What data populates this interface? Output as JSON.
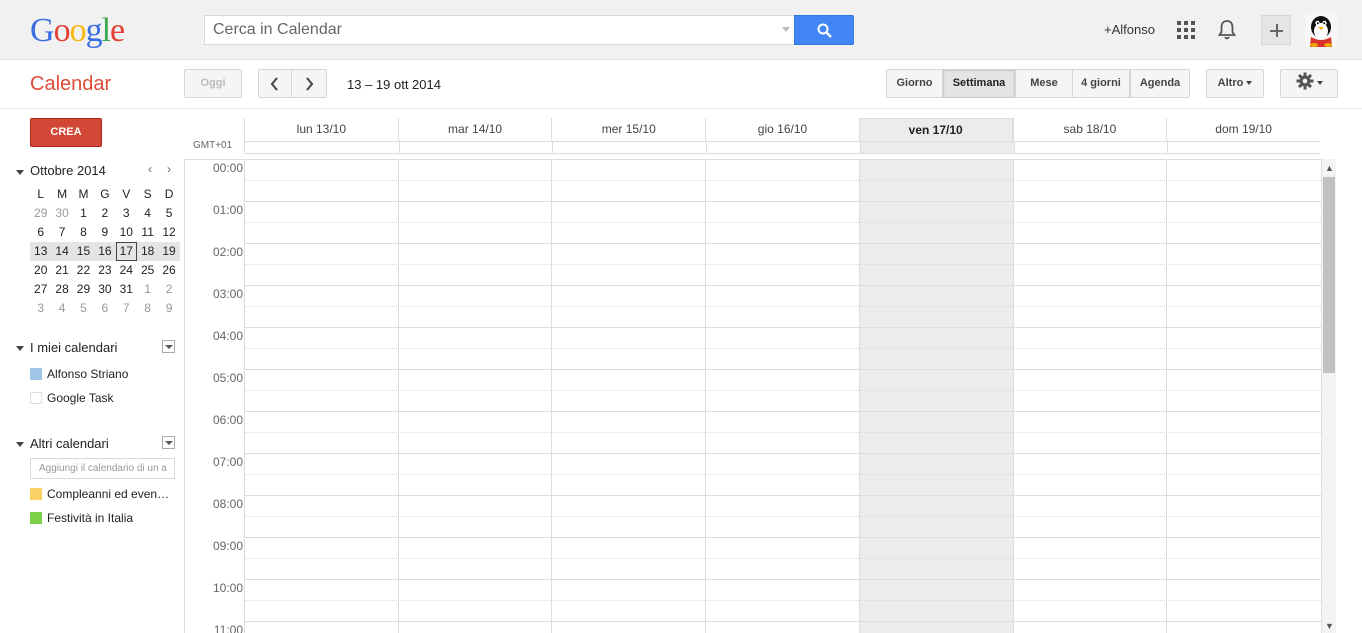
{
  "header": {
    "logo_letters": [
      {
        "ch": "G",
        "color": "#3b6ee3"
      },
      {
        "ch": "o",
        "color": "#e44134"
      },
      {
        "ch": "o",
        "color": "#f5b90f"
      },
      {
        "ch": "g",
        "color": "#3b6ee3"
      },
      {
        "ch": "l",
        "color": "#39a94c"
      },
      {
        "ch": "e",
        "color": "#e44134"
      }
    ],
    "search_placeholder": "Cerca in Calendar",
    "user_label": "+Alfonso"
  },
  "appbar": {
    "title": "Calendar",
    "today_label": "Oggi",
    "date_range": "13 – 19 ott 2014",
    "views": {
      "day": "Giorno",
      "week": "Settimana",
      "month": "Mese",
      "four_days": "4 giorni",
      "agenda": "Agenda"
    },
    "more_label": "Altro"
  },
  "sidebar": {
    "create_label": "CREA",
    "mini_calendar": {
      "title": "Ottobre 2014",
      "weekdays": [
        "L",
        "M",
        "M",
        "G",
        "V",
        "S",
        "D"
      ],
      "weeks": [
        [
          {
            "d": "29",
            "dim": true
          },
          {
            "d": "30",
            "dim": true
          },
          {
            "d": "1"
          },
          {
            "d": "2"
          },
          {
            "d": "3"
          },
          {
            "d": "4"
          },
          {
            "d": "5"
          }
        ],
        [
          {
            "d": "6"
          },
          {
            "d": "7"
          },
          {
            "d": "8"
          },
          {
            "d": "9"
          },
          {
            "d": "10"
          },
          {
            "d": "11"
          },
          {
            "d": "12"
          }
        ],
        [
          {
            "d": "13"
          },
          {
            "d": "14"
          },
          {
            "d": "15"
          },
          {
            "d": "16"
          },
          {
            "d": "17",
            "today": true
          },
          {
            "d": "18"
          },
          {
            "d": "19"
          }
        ],
        [
          {
            "d": "20"
          },
          {
            "d": "21"
          },
          {
            "d": "22"
          },
          {
            "d": "23"
          },
          {
            "d": "24"
          },
          {
            "d": "25"
          },
          {
            "d": "26"
          }
        ],
        [
          {
            "d": "27"
          },
          {
            "d": "28"
          },
          {
            "d": "29"
          },
          {
            "d": "30"
          },
          {
            "d": "31"
          },
          {
            "d": "1",
            "dim": true
          },
          {
            "d": "2",
            "dim": true
          }
        ],
        [
          {
            "d": "3",
            "dim": true
          },
          {
            "d": "4",
            "dim": true
          },
          {
            "d": "5",
            "dim": true
          },
          {
            "d": "6",
            "dim": true
          },
          {
            "d": "7",
            "dim": true
          },
          {
            "d": "8",
            "dim": true
          },
          {
            "d": "9",
            "dim": true
          }
        ]
      ],
      "selected_week_index": 2
    },
    "my_calendars": {
      "title": "I miei calendari",
      "items": [
        {
          "label": "Alfonso Striano",
          "color": "#9fc6e7"
        },
        {
          "label": "Google Task",
          "color": "#ffffff"
        }
      ]
    },
    "other_calendars": {
      "title": "Altri calendari",
      "add_placeholder": "Aggiungi il calendario di un a",
      "items": [
        {
          "label": "Compleanni ed even…",
          "color": "#fad165"
        },
        {
          "label": "Festività in Italia",
          "color": "#7bd148"
        }
      ]
    }
  },
  "grid": {
    "timezone": "GMT+01",
    "days": [
      {
        "label": "lun 13/10"
      },
      {
        "label": "mar 14/10"
      },
      {
        "label": "mer 15/10"
      },
      {
        "label": "gio 16/10"
      },
      {
        "label": "ven 17/10",
        "today": true
      },
      {
        "label": "sab 18/10"
      },
      {
        "label": "dom 19/10"
      }
    ],
    "hours": [
      "00:00",
      "01:00",
      "02:00",
      "03:00",
      "04:00",
      "05:00",
      "06:00",
      "07:00",
      "08:00",
      "09:00",
      "10:00",
      "11:00"
    ]
  }
}
